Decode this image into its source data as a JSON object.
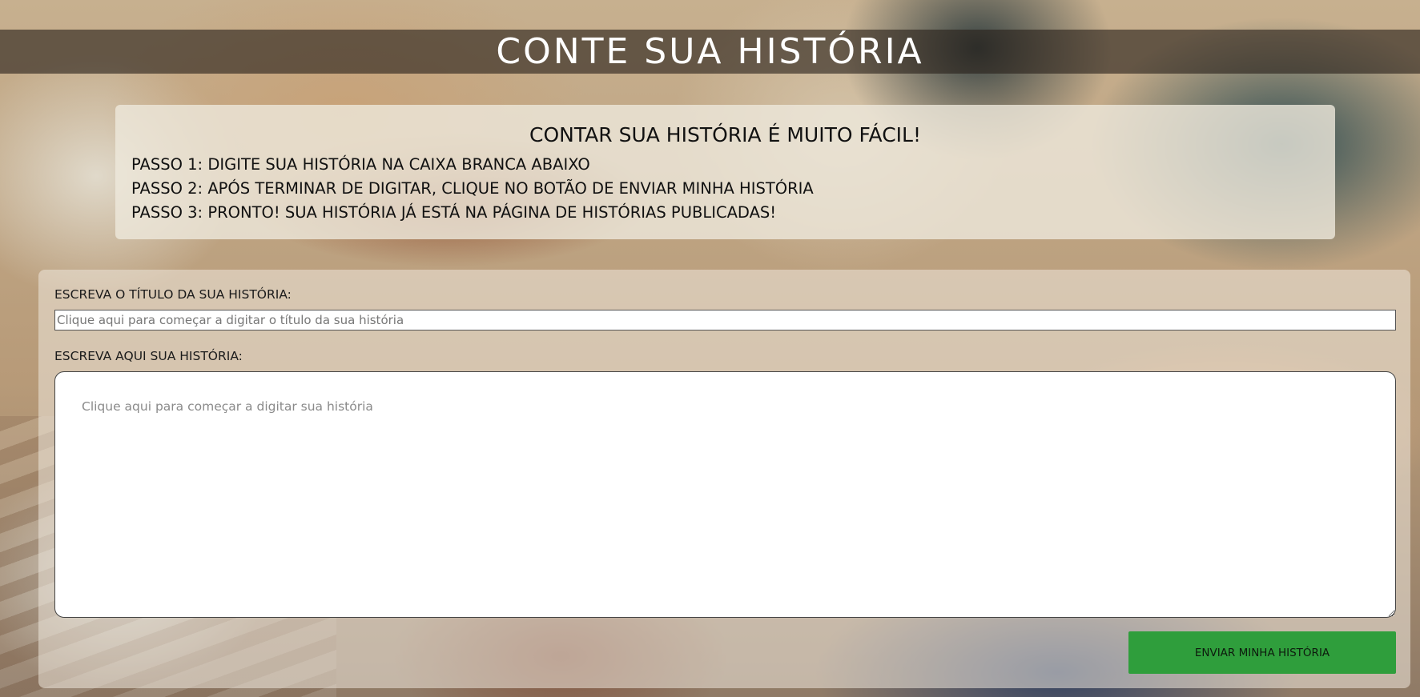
{
  "page": {
    "title": "CONTE SUA HISTÓRIA"
  },
  "instructions": {
    "heading": "CONTAR SUA HISTÓRIA É MUITO FÁCIL!",
    "steps": [
      "PASSO 1: DIGITE SUA HISTÓRIA NA CAIXA BRANCA ABAIXO",
      "PASSO 2: APÓS TERMINAR DE DIGITAR, CLIQUE NO BOTÃO DE ENVIAR MINHA HISTÓRIA",
      "PASSO 3: PRONTO! SUA HISTÓRIA JÁ ESTÁ NA PÁGINA DE HISTÓRIAS PUBLICADAS!"
    ]
  },
  "form": {
    "title_label": "ESCREVA O TÍTULO DA SUA HISTÓRIA:",
    "title_value": "",
    "title_placeholder": "Clique aqui para começar a digitar o título da sua história",
    "story_label": "ESCREVA AQUI SUA HISTÓRIA:",
    "story_value": "",
    "story_placeholder": "Clique aqui para começar a digitar sua história",
    "submit_label": "ENVIAR MINHA HISTÓRIA"
  },
  "colors": {
    "title_bar": "#28201a",
    "submit_button": "#2f9e3c",
    "panel": "#eee8dc"
  }
}
